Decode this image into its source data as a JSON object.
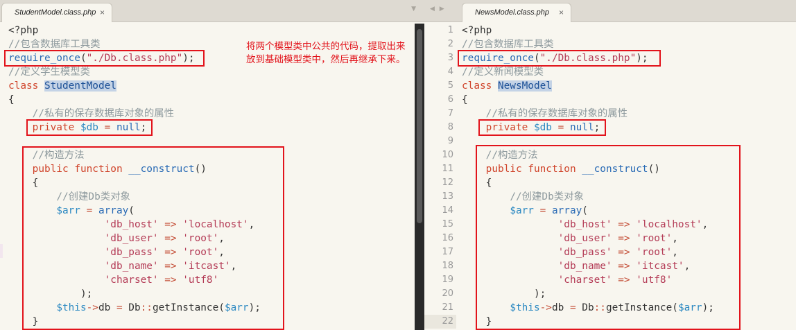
{
  "left_pane": {
    "tab_label": "StudentModel.class.php",
    "tab_close": "×",
    "tab_arrows": "▼",
    "code": [
      [
        {
          "t": "<?php",
          "c": "plain"
        }
      ],
      [
        {
          "t": "//包含数据库工具类",
          "c": "comment"
        }
      ],
      [
        {
          "t": "require_once",
          "c": "fn"
        },
        {
          "t": "(",
          "c": "plain"
        },
        {
          "t": "\"./Db.class.php\"",
          "c": "str"
        },
        {
          "t": ");",
          "c": "plain"
        }
      ],
      [
        {
          "t": "//定义学生模型类",
          "c": "comment"
        }
      ],
      [
        {
          "t": "class ",
          "c": "kw"
        },
        {
          "t": "StudentModel",
          "c": "class"
        }
      ],
      [
        {
          "t": "{",
          "c": "plain"
        }
      ],
      [
        {
          "t": "    ",
          "c": "plain"
        },
        {
          "t": "//私有的保存数据库对象的属性",
          "c": "comment"
        }
      ],
      [
        {
          "t": "    ",
          "c": "plain"
        },
        {
          "t": "private ",
          "c": "kw"
        },
        {
          "t": "$db",
          "c": "var"
        },
        {
          "t": " = ",
          "c": "op"
        },
        {
          "t": "null",
          "c": "fn"
        },
        {
          "t": ";",
          "c": "plain"
        }
      ],
      [
        {
          "t": "",
          "c": "plain"
        }
      ],
      [
        {
          "t": "    ",
          "c": "plain"
        },
        {
          "t": "//构造方法",
          "c": "comment"
        }
      ],
      [
        {
          "t": "    ",
          "c": "plain"
        },
        {
          "t": "public ",
          "c": "kw"
        },
        {
          "t": "function ",
          "c": "kw"
        },
        {
          "t": "__construct",
          "c": "under"
        },
        {
          "t": "()",
          "c": "plain"
        }
      ],
      [
        {
          "t": "    {",
          "c": "plain"
        }
      ],
      [
        {
          "t": "        ",
          "c": "plain"
        },
        {
          "t": "//创建Db类对象",
          "c": "comment"
        }
      ],
      [
        {
          "t": "        ",
          "c": "plain"
        },
        {
          "t": "$arr",
          "c": "var"
        },
        {
          "t": " = ",
          "c": "op"
        },
        {
          "t": "array",
          "c": "fn"
        },
        {
          "t": "(",
          "c": "plain"
        }
      ],
      [
        {
          "t": "                ",
          "c": "plain"
        },
        {
          "t": "'db_host'",
          "c": "str"
        },
        {
          "t": " => ",
          "c": "op"
        },
        {
          "t": "'localhost'",
          "c": "str"
        },
        {
          "t": ",",
          "c": "plain"
        }
      ],
      [
        {
          "t": "                ",
          "c": "plain"
        },
        {
          "t": "'db_user'",
          "c": "str"
        },
        {
          "t": " => ",
          "c": "op"
        },
        {
          "t": "'root'",
          "c": "str"
        },
        {
          "t": ",",
          "c": "plain"
        }
      ],
      [
        {
          "t": "                ",
          "c": "plain"
        },
        {
          "t": "'db_pass'",
          "c": "str"
        },
        {
          "t": " => ",
          "c": "op"
        },
        {
          "t": "'root'",
          "c": "str"
        },
        {
          "t": ",",
          "c": "plain"
        }
      ],
      [
        {
          "t": "                ",
          "c": "plain"
        },
        {
          "t": "'db_name'",
          "c": "str"
        },
        {
          "t": " => ",
          "c": "op"
        },
        {
          "t": "'itcast'",
          "c": "str"
        },
        {
          "t": ",",
          "c": "plain"
        }
      ],
      [
        {
          "t": "                ",
          "c": "plain"
        },
        {
          "t": "'charset'",
          "c": "str"
        },
        {
          "t": " => ",
          "c": "op"
        },
        {
          "t": "'utf8'",
          "c": "str"
        }
      ],
      [
        {
          "t": "            );",
          "c": "plain"
        }
      ],
      [
        {
          "t": "        ",
          "c": "plain"
        },
        {
          "t": "$this",
          "c": "var"
        },
        {
          "t": "->",
          "c": "op"
        },
        {
          "t": "db",
          "c": "plain"
        },
        {
          "t": " = ",
          "c": "op"
        },
        {
          "t": "Db",
          "c": "plain"
        },
        {
          "t": "::",
          "c": "op"
        },
        {
          "t": "getInstance",
          "c": "plain"
        },
        {
          "t": "(",
          "c": "plain"
        },
        {
          "t": "$arr",
          "c": "var"
        },
        {
          "t": ");",
          "c": "plain"
        }
      ],
      [
        {
          "t": "    }",
          "c": "plain"
        }
      ]
    ]
  },
  "right_pane": {
    "tab_label": "NewsModel.class.php",
    "tab_close": "×",
    "tab_arrows": "◀ ▶",
    "line_numbers": [
      "1",
      "2",
      "3",
      "4",
      "5",
      "6",
      "7",
      "8",
      "9",
      "10",
      "11",
      "12",
      "13",
      "14",
      "15",
      "16",
      "17",
      "18",
      "19",
      "20",
      "21",
      "22"
    ],
    "current_line": "22",
    "code": [
      [
        {
          "t": "<?php",
          "c": "plain"
        }
      ],
      [
        {
          "t": "//包含数据库工具类",
          "c": "comment"
        }
      ],
      [
        {
          "t": "require_once",
          "c": "fn"
        },
        {
          "t": "(",
          "c": "plain"
        },
        {
          "t": "\"./Db.class.php\"",
          "c": "str"
        },
        {
          "t": ");",
          "c": "plain"
        }
      ],
      [
        {
          "t": "//定义新闻模型类",
          "c": "comment"
        }
      ],
      [
        {
          "t": "class ",
          "c": "kw"
        },
        {
          "t": "NewsModel",
          "c": "class"
        }
      ],
      [
        {
          "t": "{",
          "c": "plain"
        }
      ],
      [
        {
          "t": "    ",
          "c": "plain"
        },
        {
          "t": "//私有的保存数据库对象的属性",
          "c": "comment"
        }
      ],
      [
        {
          "t": "    ",
          "c": "plain"
        },
        {
          "t": "private ",
          "c": "kw"
        },
        {
          "t": "$db",
          "c": "var"
        },
        {
          "t": " = ",
          "c": "op"
        },
        {
          "t": "null",
          "c": "fn"
        },
        {
          "t": ";",
          "c": "plain"
        }
      ],
      [
        {
          "t": "",
          "c": "plain"
        }
      ],
      [
        {
          "t": "    ",
          "c": "plain"
        },
        {
          "t": "//构造方法",
          "c": "comment"
        }
      ],
      [
        {
          "t": "    ",
          "c": "plain"
        },
        {
          "t": "public ",
          "c": "kw"
        },
        {
          "t": "function ",
          "c": "kw"
        },
        {
          "t": "__construct",
          "c": "under"
        },
        {
          "t": "()",
          "c": "plain"
        }
      ],
      [
        {
          "t": "    {",
          "c": "plain"
        }
      ],
      [
        {
          "t": "        ",
          "c": "plain"
        },
        {
          "t": "//创建Db类对象",
          "c": "comment"
        }
      ],
      [
        {
          "t": "        ",
          "c": "plain"
        },
        {
          "t": "$arr",
          "c": "var"
        },
        {
          "t": " = ",
          "c": "op"
        },
        {
          "t": "array",
          "c": "fn"
        },
        {
          "t": "(",
          "c": "plain"
        }
      ],
      [
        {
          "t": "                ",
          "c": "plain"
        },
        {
          "t": "'db_host'",
          "c": "str"
        },
        {
          "t": " => ",
          "c": "op"
        },
        {
          "t": "'localhost'",
          "c": "str"
        },
        {
          "t": ",",
          "c": "plain"
        }
      ],
      [
        {
          "t": "                ",
          "c": "plain"
        },
        {
          "t": "'db_user'",
          "c": "str"
        },
        {
          "t": " => ",
          "c": "op"
        },
        {
          "t": "'root'",
          "c": "str"
        },
        {
          "t": ",",
          "c": "plain"
        }
      ],
      [
        {
          "t": "                ",
          "c": "plain"
        },
        {
          "t": "'db_pass'",
          "c": "str"
        },
        {
          "t": " => ",
          "c": "op"
        },
        {
          "t": "'root'",
          "c": "str"
        },
        {
          "t": ",",
          "c": "plain"
        }
      ],
      [
        {
          "t": "                ",
          "c": "plain"
        },
        {
          "t": "'db_name'",
          "c": "str"
        },
        {
          "t": " => ",
          "c": "op"
        },
        {
          "t": "'itcast'",
          "c": "str"
        },
        {
          "t": ",",
          "c": "plain"
        }
      ],
      [
        {
          "t": "                ",
          "c": "plain"
        },
        {
          "t": "'charset'",
          "c": "str"
        },
        {
          "t": " => ",
          "c": "op"
        },
        {
          "t": "'utf8'",
          "c": "str"
        }
      ],
      [
        {
          "t": "            );",
          "c": "plain"
        }
      ],
      [
        {
          "t": "        ",
          "c": "plain"
        },
        {
          "t": "$this",
          "c": "var"
        },
        {
          "t": "->",
          "c": "op"
        },
        {
          "t": "db",
          "c": "plain"
        },
        {
          "t": " = ",
          "c": "op"
        },
        {
          "t": "Db",
          "c": "plain"
        },
        {
          "t": "::",
          "c": "op"
        },
        {
          "t": "getInstance",
          "c": "plain"
        },
        {
          "t": "(",
          "c": "plain"
        },
        {
          "t": "$arr",
          "c": "var"
        },
        {
          "t": ");",
          "c": "plain"
        }
      ],
      [
        {
          "t": "    }",
          "c": "plain"
        }
      ]
    ]
  },
  "annotation": {
    "text": "将两个模型类中公共的代码，提取出来放到基础模型类中，然后再继承下来。"
  },
  "colors": {
    "highlight_box": "#e2131b",
    "background": "#f8f6ef"
  }
}
